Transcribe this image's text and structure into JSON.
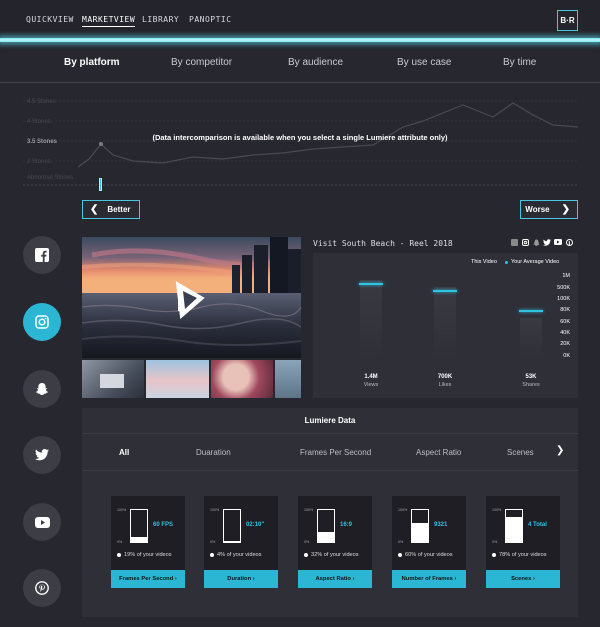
{
  "nav": {
    "items": [
      {
        "label": "QUICKVIEW",
        "active": false
      },
      {
        "label": "MARKETVIEW",
        "active": true
      },
      {
        "label": "LIBRARY",
        "active": false
      },
      {
        "label": "PANOPTIC",
        "active": false
      }
    ],
    "logo": "B·R"
  },
  "tabs": [
    "By platform",
    "By competitor",
    "By audience",
    "By use case",
    "By time"
  ],
  "active_tab": "By platform",
  "chart": {
    "y_labels": [
      "4.5 Stones",
      "4 Stones",
      "3.5 Stones",
      "3 Stones",
      "Abnormal Stones"
    ],
    "highlight_label": "3.5 Stones",
    "overlay": "(Data intercomparison is available when you select a single Lumiere attribute only)"
  },
  "better_label": "Better",
  "worse_label": "Worse",
  "sidebar": [
    "facebook-icon",
    "instagram-icon",
    "snapchat-icon",
    "twitter-icon",
    "youtube-icon",
    "pinterest-icon"
  ],
  "active_platform": "instagram",
  "video": {
    "title": "Visit South Beach - Reel 2018"
  },
  "stats": {
    "legend_this": "This Video",
    "legend_avg": "Your Average Video",
    "y_axis": [
      "1M",
      "500K",
      "100K",
      "80K",
      "60K",
      "40K",
      "20K",
      "0K"
    ],
    "columns": [
      {
        "value": "1.4M",
        "label": "Views"
      },
      {
        "value": "700K",
        "label": "Likes"
      },
      {
        "value": "53K",
        "label": "Shares"
      }
    ],
    "accent": "#2ec3e0"
  },
  "lumiere": {
    "title": "Lumiere Data",
    "tabs": [
      "All",
      "Duaration",
      "Frames Per Second",
      "Aspect Ratio",
      "Scenes"
    ],
    "cards": [
      {
        "value": "60 FPS",
        "fill": 0.17,
        "pct": "19% of your videos",
        "button": "Frames Per Second",
        "top": "100%",
        "bottom": "0%"
      },
      {
        "value": "02:10\"",
        "fill": 0.03,
        "pct": "4% of your videos",
        "button": "Duration",
        "top": "100%",
        "bottom": "0%"
      },
      {
        "value": "16:9",
        "fill": 0.3,
        "pct": "32% of your videos",
        "button": "Aspect Ratio",
        "top": "100%",
        "bottom": "0%"
      },
      {
        "value": "9321",
        "fill": 0.6,
        "pct": "60% of your videos",
        "button": "Number of Frames",
        "top": "100%",
        "bottom": "0%"
      },
      {
        "value": "4 Total",
        "fill": 0.78,
        "pct": "78% of your videos",
        "button": "Scenes",
        "top": "100%",
        "bottom": "0%"
      }
    ]
  }
}
